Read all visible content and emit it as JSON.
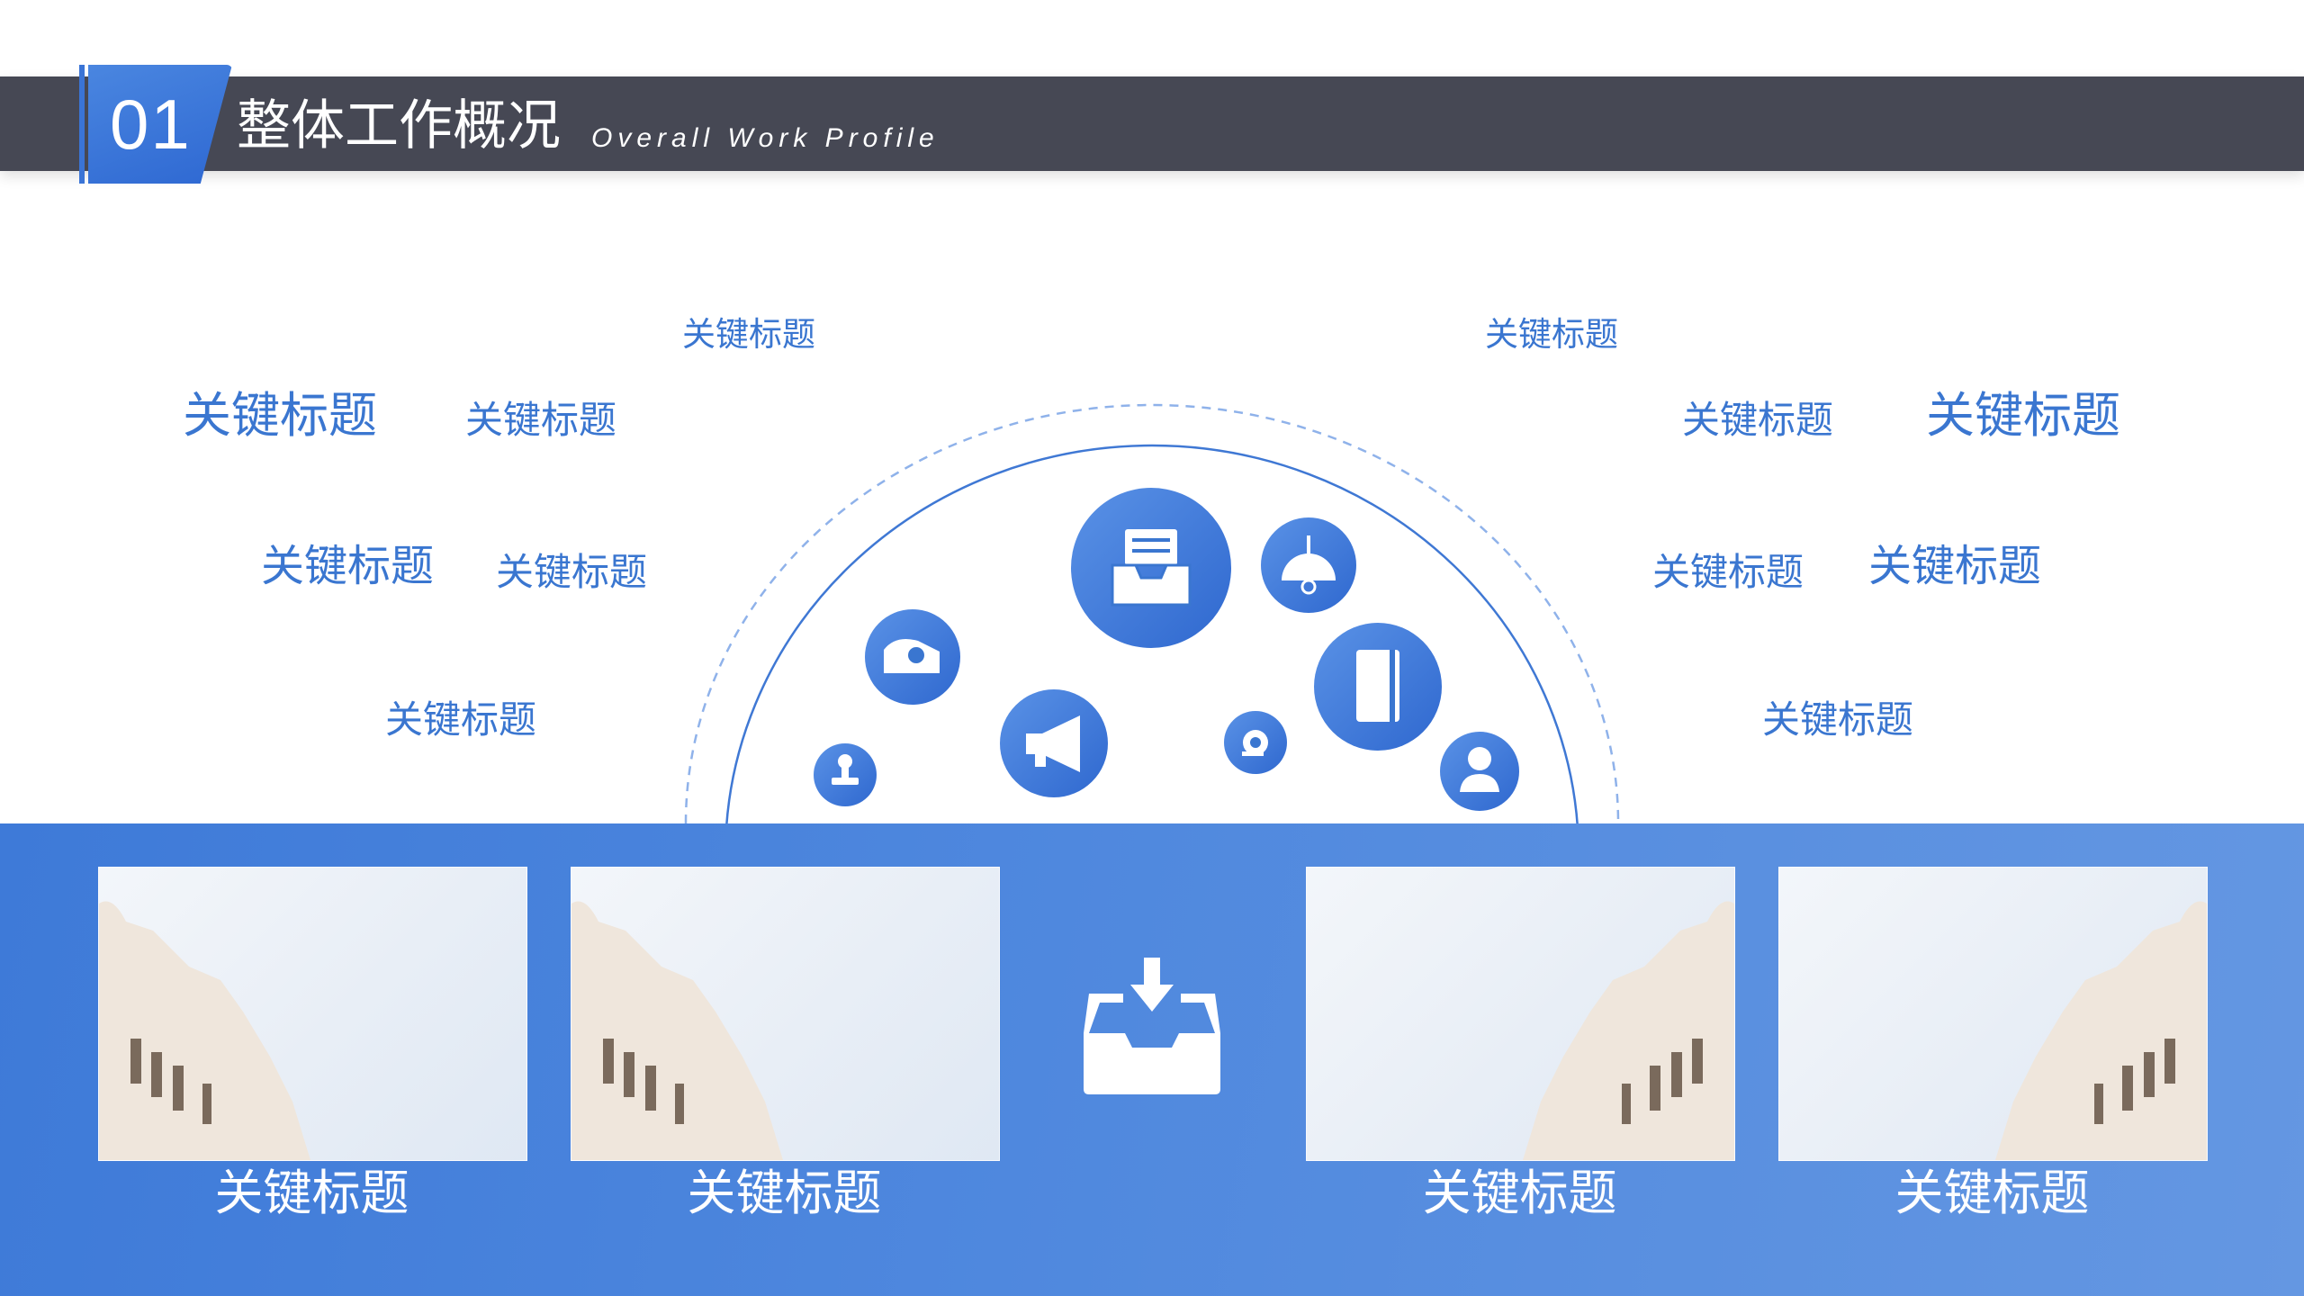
{
  "header": {
    "number": "01",
    "title_cn": "整体工作概况",
    "title_en": "Overall Work Profile"
  },
  "keywords": {
    "left": [
      "关键标题",
      "关键标题",
      "关键标题",
      "关键标题",
      "关键标题",
      "关键标题"
    ],
    "right": [
      "关键标题",
      "关键标题",
      "关键标题",
      "关键标题",
      "关键标题",
      "关键标题"
    ]
  },
  "icons": [
    "inbox-tray-icon",
    "pendant-lamp-icon",
    "tape-dispenser-icon",
    "notebook-icon",
    "megaphone-icon",
    "stamp-icon",
    "tape-roll-icon",
    "person-icon",
    "download-tray-icon"
  ],
  "cards": [
    {
      "caption": "关键标题"
    },
    {
      "caption": "关键标题"
    },
    {
      "caption": "关键标题"
    },
    {
      "caption": "关键标题"
    }
  ],
  "colors": {
    "accent": "#3a76d0",
    "header_bar": "#464854",
    "band": "#4f88de"
  }
}
